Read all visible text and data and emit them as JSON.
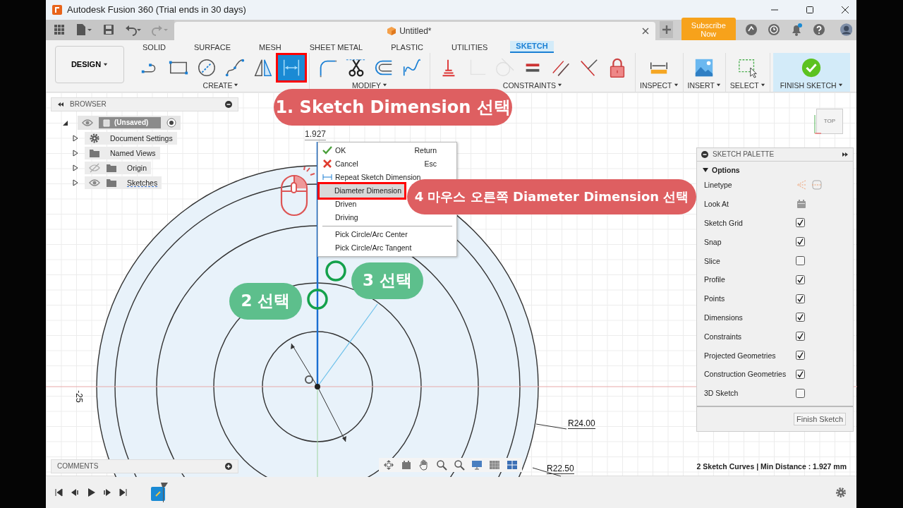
{
  "window": {
    "title": "Autodesk Fusion 360 (Trial ends in 30 days)"
  },
  "document_tab": {
    "title": "Untitled*"
  },
  "subscribe_button": {
    "label": "Subscribe Now"
  },
  "workspace_button": {
    "label": "DESIGN"
  },
  "toolbar_tabs": [
    {
      "label": "SOLID",
      "selected": false
    },
    {
      "label": "SURFACE",
      "selected": false
    },
    {
      "label": "MESH",
      "selected": false
    },
    {
      "label": "SHEET METAL",
      "selected": false
    },
    {
      "label": "PLASTIC",
      "selected": false
    },
    {
      "label": "UTILITIES",
      "selected": false
    },
    {
      "label": "SKETCH",
      "selected": true
    }
  ],
  "tool_groups": [
    {
      "label": "CREATE",
      "kind": "normal",
      "tools": [
        {
          "kind": "line",
          "selected": false,
          "disabled": false,
          "annotated": false
        },
        {
          "kind": "rectangle",
          "selected": false,
          "disabled": false,
          "annotated": false
        },
        {
          "kind": "circle",
          "selected": false,
          "disabled": false,
          "annotated": false
        },
        {
          "kind": "spline",
          "selected": false,
          "disabled": false,
          "annotated": false
        },
        {
          "kind": "mirror",
          "selected": false,
          "disabled": false,
          "annotated": false
        },
        {
          "kind": "dimension",
          "selected": true,
          "disabled": false,
          "annotated": true
        }
      ]
    },
    {
      "label": "MODIFY",
      "kind": "normal",
      "tools": [
        {
          "kind": "fillet",
          "selected": false,
          "disabled": false,
          "annotated": false
        },
        {
          "kind": "trim",
          "selected": false,
          "disabled": false,
          "annotated": false
        },
        {
          "kind": "offset",
          "selected": false,
          "disabled": false,
          "annotated": false
        },
        {
          "kind": "curve",
          "selected": false,
          "disabled": false,
          "annotated": false
        }
      ]
    },
    {
      "label": "CONSTRAINTS",
      "kind": "normal",
      "tools": [
        {
          "kind": "fix",
          "selected": false,
          "disabled": false,
          "annotated": false
        },
        {
          "kind": "coincident",
          "selected": false,
          "disabled": true,
          "annotated": false
        },
        {
          "kind": "tangent",
          "selected": false,
          "disabled": true,
          "annotated": false
        },
        {
          "kind": "equal",
          "selected": false,
          "disabled": false,
          "annotated": false
        },
        {
          "kind": "parallel",
          "selected": false,
          "disabled": false,
          "annotated": false
        },
        {
          "kind": "perpendicular",
          "selected": false,
          "disabled": false,
          "annotated": false
        },
        {
          "kind": "lock",
          "selected": false,
          "disabled": false,
          "annotated": false
        }
      ]
    },
    {
      "label": "INSPECT",
      "kind": "normal",
      "tools": [
        {
          "kind": "measure",
          "selected": false,
          "disabled": false,
          "annotated": false
        }
      ]
    },
    {
      "label": "INSERT",
      "kind": "normal",
      "tools": [
        {
          "kind": "image",
          "selected": false,
          "disabled": false,
          "annotated": false
        }
      ]
    },
    {
      "label": "SELECT",
      "kind": "normal",
      "tools": [
        {
          "kind": "select",
          "selected": false,
          "disabled": false,
          "annotated": false
        }
      ]
    },
    {
      "label": "FINISH SKETCH",
      "kind": "finish",
      "tools": [
        {
          "kind": "finish",
          "selected": false,
          "disabled": false,
          "annotated": false
        }
      ]
    }
  ],
  "browser": {
    "title": "BROWSER",
    "root": {
      "label": "(Unsaved)",
      "expanded": true,
      "children": [
        {
          "label": "Document Settings",
          "kind": "settings",
          "expanded": false
        },
        {
          "label": "Named Views",
          "kind": "folder",
          "expanded": false
        },
        {
          "label": "Origin",
          "kind": "folder",
          "visible": false,
          "expanded": false
        },
        {
          "label": "Sketches",
          "kind": "sketches",
          "visible": true,
          "expanded": false
        }
      ]
    }
  },
  "dimension_label": "1.927",
  "axis_label": "-25",
  "radius_labels": [
    "R24.00",
    "R22.50"
  ],
  "context_menu": {
    "sections": [
      [
        {
          "label": "OK",
          "shortcut": "Return",
          "kind": "ok",
          "selected": false,
          "annotated": false
        },
        {
          "label": "Cancel",
          "shortcut": "Esc",
          "kind": "cancel",
          "selected": false,
          "annotated": false
        },
        {
          "label": "Repeat Sketch Dimension",
          "kind": "repeat",
          "selected": false,
          "annotated": false
        },
        {
          "label": "Diameter Dimension",
          "kind": "plain",
          "selected": true,
          "annotated": true
        },
        {
          "label": "Driven",
          "kind": "plain",
          "selected": false,
          "annotated": false
        },
        {
          "label": "Driving",
          "kind": "plain",
          "selected": false,
          "annotated": false
        }
      ],
      [
        {
          "label": "Pick Circle/Arc Center",
          "kind": "plain",
          "selected": false,
          "annotated": false
        },
        {
          "label": "Pick Circle/Arc Tangent",
          "kind": "plain",
          "selected": false,
          "annotated": false
        }
      ]
    ]
  },
  "callouts": [
    {
      "text": "1. Sketch Dimension 선택",
      "color": "#de5f61"
    },
    {
      "text": "2 선택",
      "color": "#5dbf8c"
    },
    {
      "text": "3 선택",
      "color": "#5dbf8c"
    },
    {
      "text": "4 마우스 오른쪽 Diameter Dimension 선택",
      "color": "#de5f61"
    }
  ],
  "sketch_palette": {
    "title": "SKETCH PALETTE",
    "section": {
      "label": "Options",
      "expanded": true
    },
    "rows": [
      {
        "label": "Linetype",
        "kind": "linetype"
      },
      {
        "label": "Look At",
        "kind": "look-at"
      },
      {
        "label": "Sketch Grid",
        "kind": "checkbox",
        "checked": true
      },
      {
        "label": "Snap",
        "kind": "checkbox",
        "checked": true
      },
      {
        "label": "Slice",
        "kind": "checkbox",
        "checked": false
      },
      {
        "label": "Profile",
        "kind": "checkbox",
        "checked": true
      },
      {
        "label": "Points",
        "kind": "checkbox",
        "checked": true
      },
      {
        "label": "Dimensions",
        "kind": "checkbox",
        "checked": true
      },
      {
        "label": "Constraints",
        "kind": "checkbox",
        "checked": true
      },
      {
        "label": "Projected Geometries",
        "kind": "checkbox",
        "checked": true
      },
      {
        "label": "Construction Geometries",
        "kind": "checkbox",
        "checked": true
      },
      {
        "label": "3D Sketch",
        "kind": "checkbox",
        "checked": false
      }
    ],
    "button": "Finish Sketch"
  },
  "view_cube": {
    "label": "TOP"
  },
  "comments": {
    "title": "COMMENTS"
  },
  "status": "2 Sketch Curves | Min Distance : 1.927 mm"
}
